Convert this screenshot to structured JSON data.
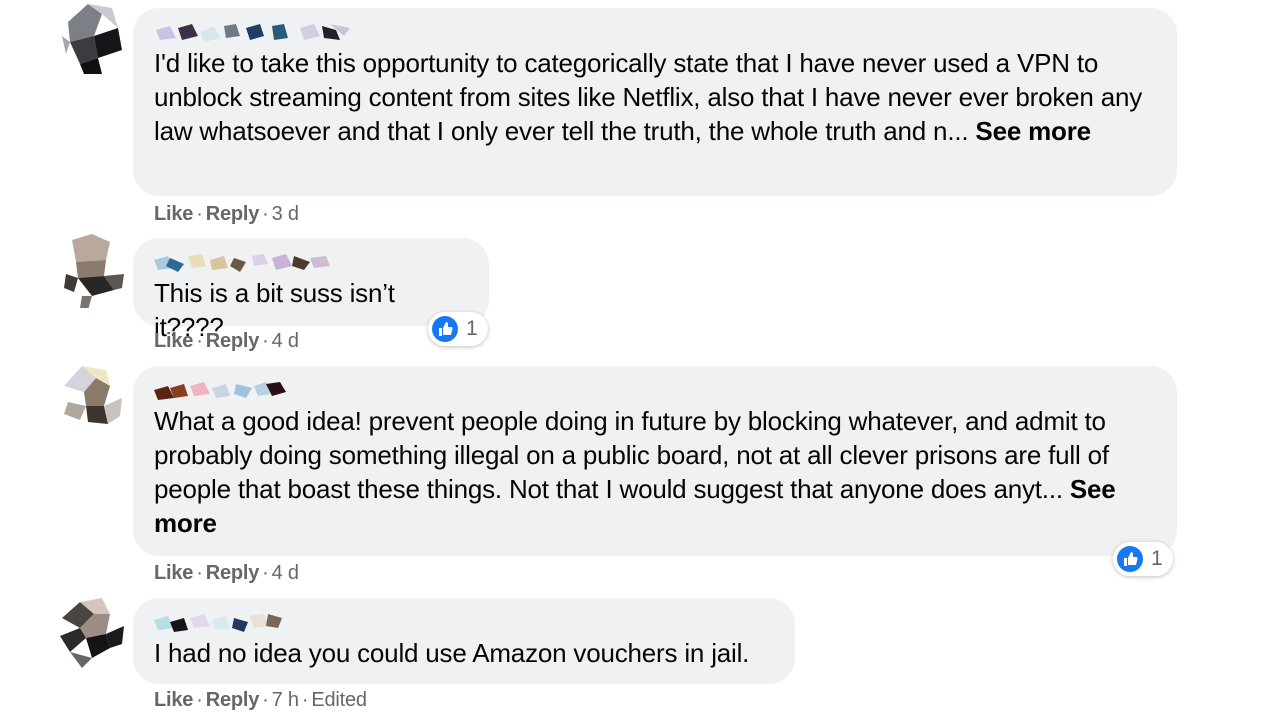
{
  "comments": [
    {
      "text": "I'd like to take this opportunity to categorically state that I have never used a VPN to unblock streaming content from sites like Netflix, also that I have never ever broken any law whatsoever and that I only ever tell the truth, the whole truth and n...",
      "see_more": "See more",
      "actions": {
        "like": "Like",
        "reply": "Reply",
        "time": "3 d"
      }
    },
    {
      "text": "This is a bit suss isn’t it????",
      "actions": {
        "like": "Like",
        "reply": "Reply",
        "time": "4 d"
      },
      "reaction_count": "1"
    },
    {
      "text": "What a good idea! prevent people doing in future by blocking whatever, and admit to probably doing something illegal on a public board, not at all clever prisons are full of people that boast these things. Not that I would suggest that anyone does anyt...",
      "see_more": "See more",
      "actions": {
        "like": "Like",
        "reply": "Reply",
        "time": "4 d"
      },
      "reaction_count": "1"
    },
    {
      "text": "I had no idea you could use Amazon vouchers in jail.",
      "actions": {
        "like": "Like",
        "reply": "Reply",
        "time": "7 h",
        "edited": "Edited"
      }
    }
  ],
  "colors": {
    "bubble": "#eff1f3",
    "meta_text": "#65676b",
    "like_blue": "#1877f2"
  },
  "icons": {
    "reaction": "thumbs-up-icon",
    "avatar": "pixelated-avatar",
    "name": "pixelated-name"
  }
}
